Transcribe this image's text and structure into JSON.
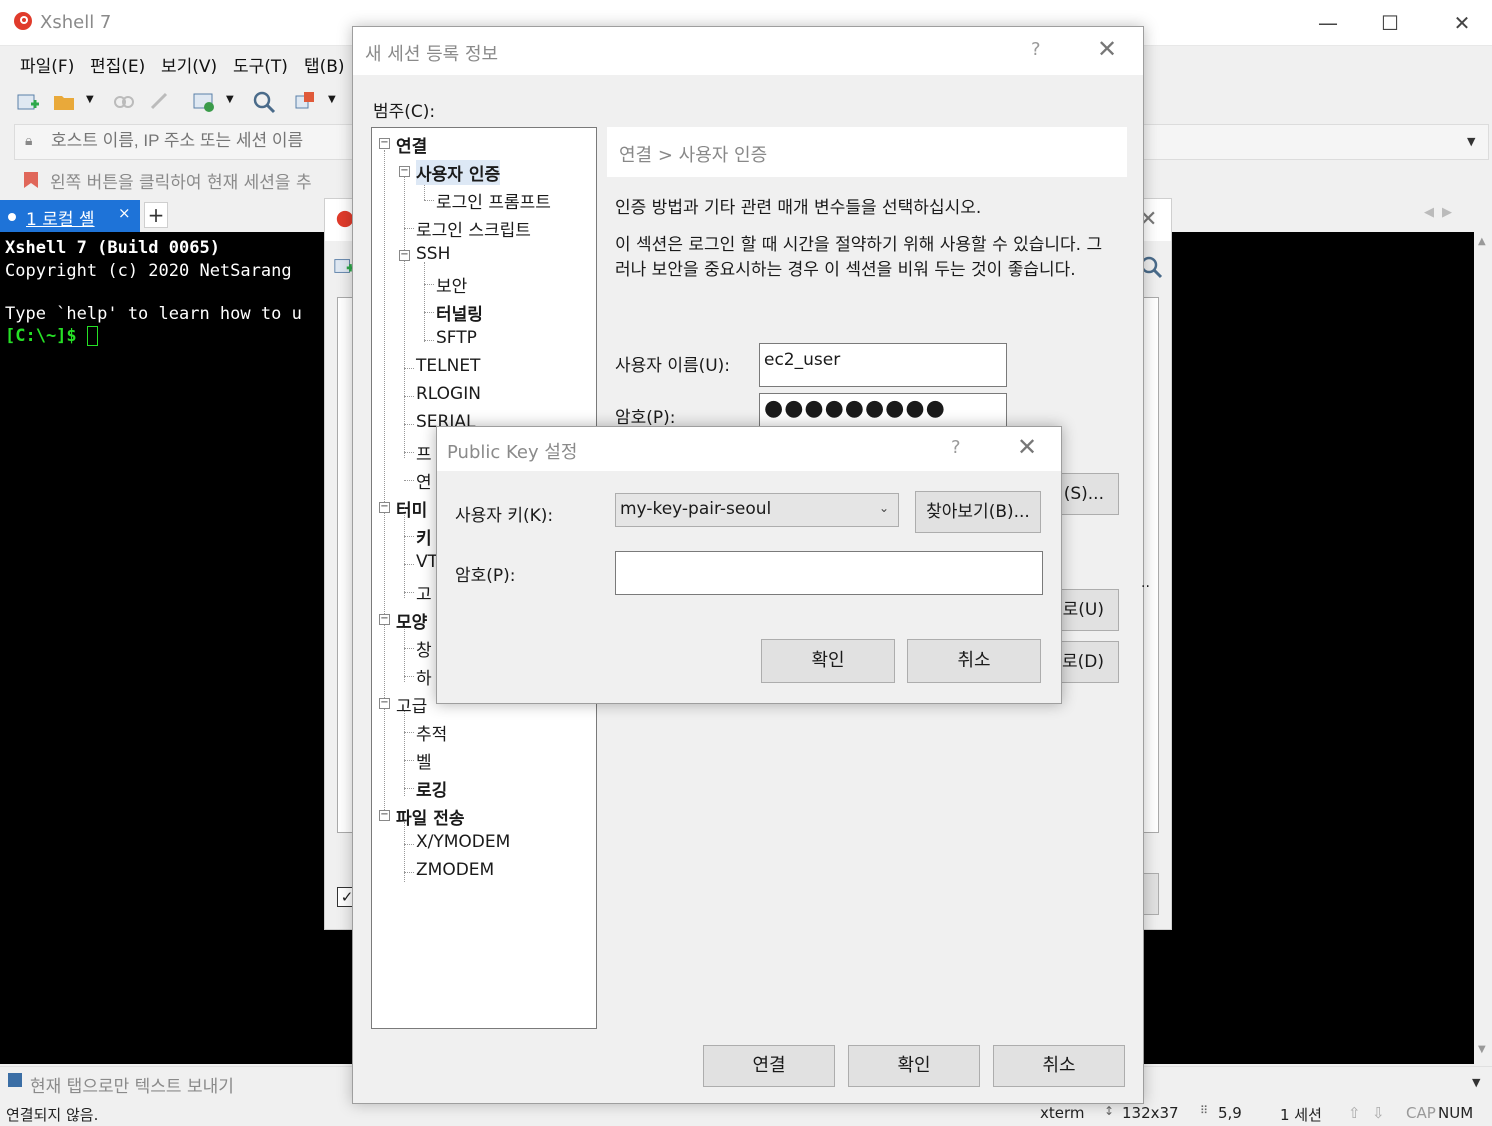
{
  "app": {
    "title": "Xshell 7",
    "minimize": "—",
    "maximize": "☐",
    "close": "✕"
  },
  "menu": [
    "파일(F)",
    "편집(E)",
    "보기(V)",
    "도구(T)",
    "탭(B)"
  ],
  "address": {
    "placeholder": "호스트 이름, IP 주소 또는 세션 이름"
  },
  "hint": {
    "text": "왼쪽 버튼을 클릭하여 현재 세션을 추"
  },
  "tab": {
    "label": "1 로컬 셸",
    "close": "×",
    "add": "+",
    "nav": "◀▶"
  },
  "terminal": {
    "line1": "Xshell 7 (Build 0065)",
    "line2": "Copyright (c) 2020 NetSarang",
    "line3": "Type `help' to learn how to u",
    "prompt": "[C:\\~]$ "
  },
  "sendbar": {
    "text": "현재 탭으로만 텍스트 보내기"
  },
  "status": {
    "connection": "연결되지 않음.",
    "term": "xterm",
    "size": "132x37",
    "pos": "5,9",
    "sessions": "1 세션",
    "caps": "CAP",
    "num": "NUM"
  },
  "new_session": {
    "title": "새 세션 등록 정보",
    "help": "?",
    "close": "✕",
    "category_label": "범주(C):",
    "tree": [
      {
        "label": "연결",
        "bold": true
      },
      {
        "label": "사용자 인증",
        "bold": true
      },
      {
        "label": "로그인 프롬프트",
        "bold": false
      },
      {
        "label": "로그인 스크립트",
        "bold": false
      },
      {
        "label": "SSH",
        "bold": false
      },
      {
        "label": "보안",
        "bold": false
      },
      {
        "label": "터널링",
        "bold": true
      },
      {
        "label": "SFTP",
        "bold": false
      },
      {
        "label": "TELNET",
        "bold": false
      },
      {
        "label": "RLOGIN",
        "bold": false
      },
      {
        "label": "SERIAL",
        "bold": false
      },
      {
        "label": "프",
        "bold": false
      },
      {
        "label": "연",
        "bold": false
      },
      {
        "label": "터미",
        "bold": true
      },
      {
        "label": "키",
        "bold": true
      },
      {
        "label": "VT",
        "bold": false
      },
      {
        "label": "고",
        "bold": false
      },
      {
        "label": "모양",
        "bold": true
      },
      {
        "label": "창",
        "bold": false
      },
      {
        "label": "하",
        "bold": false
      },
      {
        "label": "고급",
        "bold": false
      },
      {
        "label": "추적",
        "bold": false
      },
      {
        "label": "벨",
        "bold": false
      },
      {
        "label": "로깅",
        "bold": true
      },
      {
        "label": "파일 전송",
        "bold": true
      },
      {
        "label": "X/YMODEM",
        "bold": false
      },
      {
        "label": "ZMODEM",
        "bold": false
      }
    ],
    "breadcrumb": "연결 > 사용자 인증",
    "desc1": "인증 방법과 기타 관련 매개 변수들을 선택하십시오.",
    "desc2": "이 섹션은 로그인 할 때 시간을 절약하기 위해 사용할 수 있습니다. 그러나 보안을 중요시하는 경우 이 섹션을 비워 두는 것이 좋습니다.",
    "username_label": "사용자 이름(U):",
    "username_value": "ec2_user",
    "password_label": "암호(P):",
    "password_value": "●●●●●●●●●",
    "side_btn1": "정(S)...",
    "side_btn2": "로(U)",
    "side_btn3": "로(D)",
    "connect_btn": "연결",
    "ok_btn": "확인",
    "cancel_btn": "취소"
  },
  "public_key": {
    "title": "Public Key 설정",
    "help": "?",
    "close": "✕",
    "userkey_label": "사용자 키(K):",
    "userkey_value": "my-key-pair-seoul",
    "browse_btn": "찾아보기(B)...",
    "pass_label": "암호(P):",
    "pass_value": "",
    "ok_btn": "확인",
    "cancel_btn": "취소"
  }
}
